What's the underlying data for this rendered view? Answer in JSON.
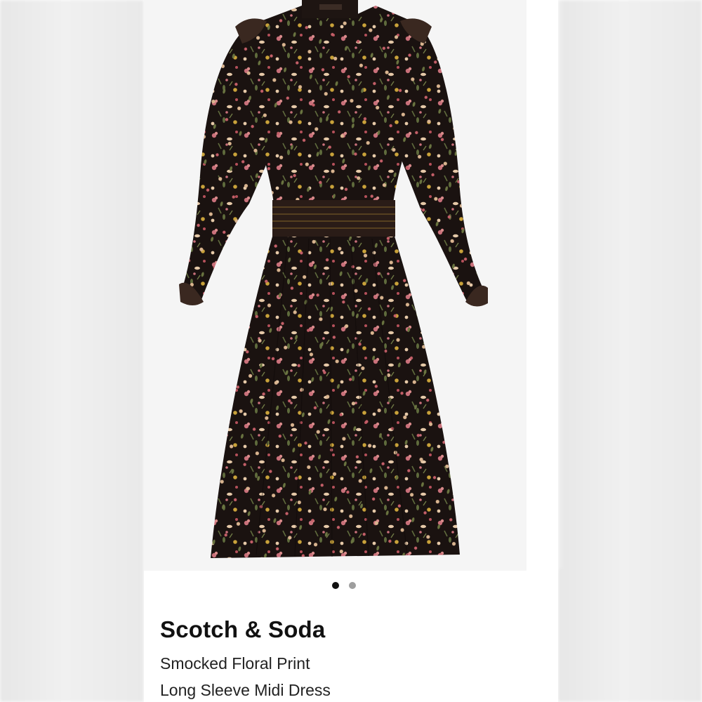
{
  "product": {
    "brand": "Scotch & Soda",
    "title_line_1": "Smocked Floral Print",
    "title_line_2": "Long Sleeve Midi Dress"
  },
  "carousel": {
    "total_images": 2,
    "active_index": 0
  },
  "colors": {
    "dress_base": "#1a1210",
    "floral_pink": "#c9707a",
    "floral_cream": "#e6c9a8",
    "floral_green": "#5f6b3c",
    "floral_yellow": "#c9a23a",
    "active_dot": "#111111",
    "inactive_dot": "#9e9e9e"
  }
}
